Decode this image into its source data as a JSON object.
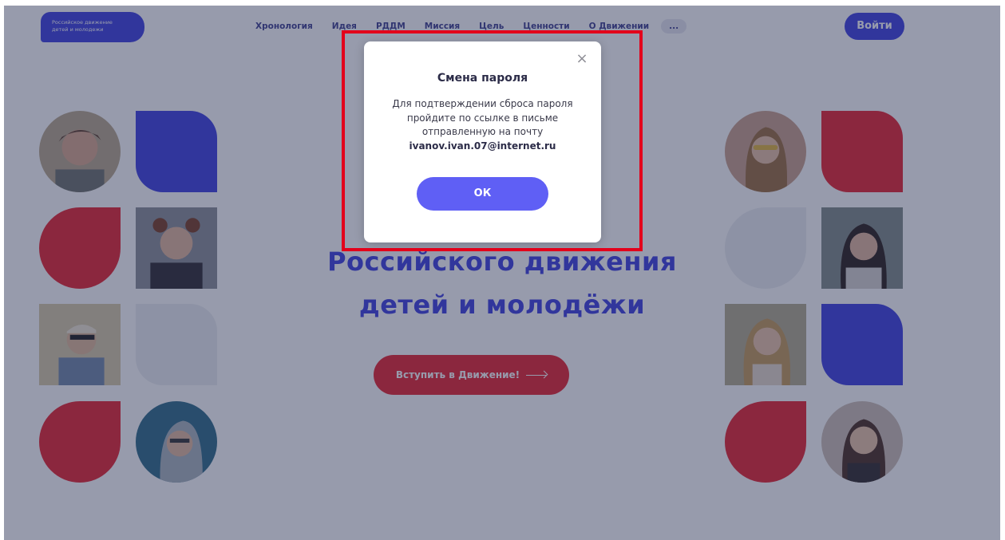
{
  "header": {
    "logo_line1": "Российское движение",
    "logo_line2": "детей и молодежи",
    "nav": [
      "Хронология",
      "Идея",
      "РДДМ",
      "Миссия",
      "Цель",
      "Ценности",
      "О Движении"
    ],
    "nav_more": "...",
    "login_label": "Войти"
  },
  "hero": {
    "line2": "Российского движения",
    "line3": "детей и молодёжи",
    "cta_label": "Вступить в Движение!"
  },
  "modal": {
    "close_glyph": "×",
    "title": "Смена пароля",
    "message": "Для подтверждении сброса пароля пройдите по ссылке в письме отправленную на почту",
    "email": "ivanov.ivan.07@internet.ru",
    "ok_label": "ОК"
  },
  "colors": {
    "brand_blue": "#3d3fe0",
    "brand_red": "#e8222d",
    "button_blue": "#5f5ff5",
    "highlight_red": "#e3001b"
  }
}
